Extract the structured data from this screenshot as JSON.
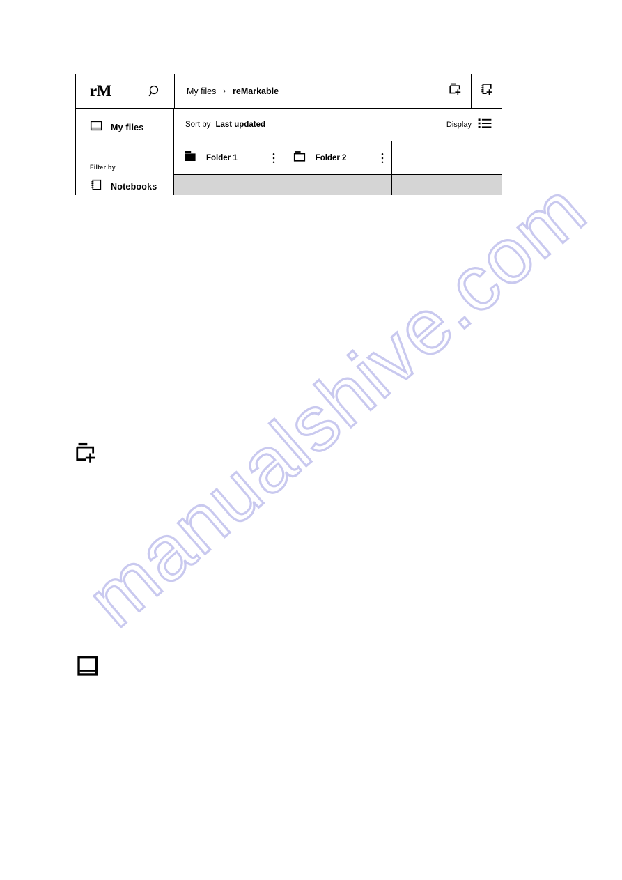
{
  "app": {
    "logo": "rM",
    "search_icon": "search-icon"
  },
  "breadcrumb": {
    "parent": "My files",
    "separator": "›",
    "current": "reMarkable"
  },
  "topbar_actions": [
    {
      "name": "new-folder-button",
      "icon": "new-folder-icon"
    },
    {
      "name": "new-notebook-button",
      "icon": "new-notebook-icon"
    }
  ],
  "sidebar": {
    "my_files_label": "My files",
    "my_files_icon": "book-icon",
    "filter_section_label": "Filter by",
    "notebooks_label": "Notebooks",
    "notebooks_icon": "notebook-icon"
  },
  "toolbar": {
    "sort_label": "Sort by",
    "sort_value": "Last updated",
    "display_label": "Display",
    "display_icon": "list-view-icon"
  },
  "folders": [
    {
      "label": "Folder 1",
      "icon": "folder-filled-icon",
      "menu_icon": "kebab-menu-icon"
    },
    {
      "label": "Folder 2",
      "icon": "folder-outline-icon",
      "menu_icon": "kebab-menu-icon"
    }
  ],
  "callouts": [
    {
      "name": "new-folder-icon-callout",
      "icon": "new-folder-icon"
    },
    {
      "name": "my-files-icon-callout",
      "icon": "book-icon"
    }
  ],
  "watermark": {
    "text": "manualshive.com",
    "color": "#c9c9ef"
  },
  "colors": {
    "line": "#000000",
    "placeholder_row": "#d5d5d5",
    "page_background": "#ffffff"
  }
}
